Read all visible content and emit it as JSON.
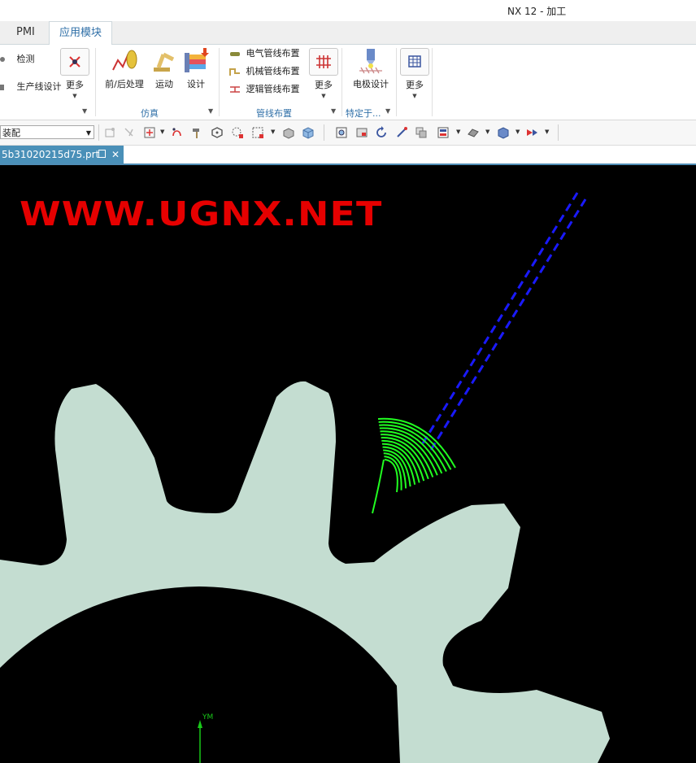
{
  "window": {
    "title": "NX 12 - 加工"
  },
  "tabs": [
    {
      "label": "PMI",
      "active": false
    },
    {
      "label": "应用模块",
      "active": true
    }
  ],
  "ribbon": {
    "group_inspection": {
      "items": [
        {
          "label": "检测"
        },
        {
          "label": "生产线设计"
        }
      ],
      "more_label": "更多"
    },
    "group_simulation": {
      "label": "仿真",
      "buttons": [
        {
          "label": "前/后处理"
        },
        {
          "label": "运动"
        },
        {
          "label": "设计"
        }
      ]
    },
    "group_routing": {
      "label": "管线布置",
      "items": [
        {
          "label": "电气管线布置"
        },
        {
          "label": "机械管线布置"
        },
        {
          "label": "逻辑管线布置"
        }
      ],
      "more_label": "更多"
    },
    "group_specific": {
      "label": "特定于...",
      "buttons": [
        {
          "label": "电极设计"
        }
      ]
    },
    "group_last": {
      "more_label": "更多"
    }
  },
  "toolbar": {
    "filter_value": "装配"
  },
  "document": {
    "tab_label": "5b31020215d75.prt"
  },
  "viewport": {
    "watermark": "WWW.UGNX.NET",
    "axis_label": "YM",
    "background": "#000000",
    "gear_color": "#c4ddd1",
    "toolpath_color": "#21ff21",
    "tool_axis_color": "#1a1aff"
  }
}
